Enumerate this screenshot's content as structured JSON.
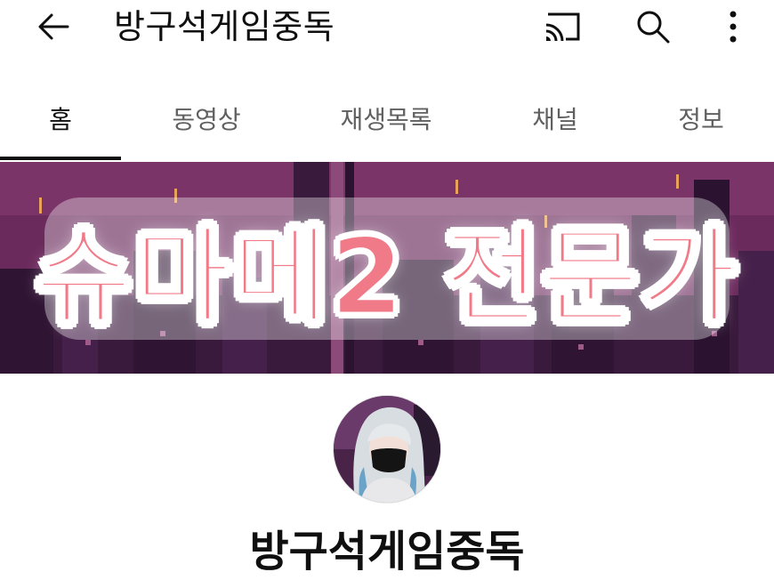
{
  "header": {
    "title": "방구석게임중독",
    "back_icon": "back-arrow-icon",
    "cast_icon": "cast-icon",
    "search_icon": "search-icon",
    "more_icon": "more-vertical-icon"
  },
  "tabs": [
    {
      "label": "홈",
      "active": true
    },
    {
      "label": "동영상",
      "active": false
    },
    {
      "label": "재생목록",
      "active": false
    },
    {
      "label": "채널",
      "active": false
    },
    {
      "label": "정보",
      "active": false
    }
  ],
  "banner": {
    "text": "슈마메2 전문가",
    "text_color": "#f17a88",
    "background_color": "#5a2550"
  },
  "channel": {
    "name": "방구석게임중독"
  }
}
